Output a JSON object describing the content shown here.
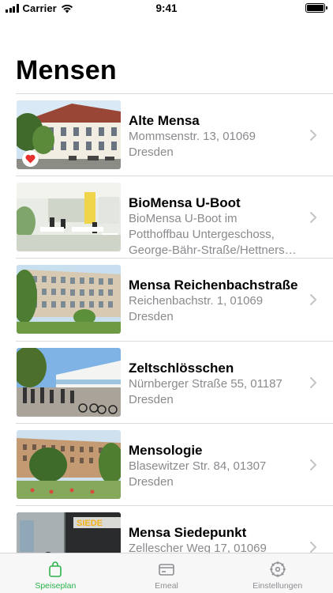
{
  "status_bar": {
    "carrier": "Carrier",
    "time": "9:41"
  },
  "page": {
    "title": "Mensen"
  },
  "mensen": [
    {
      "name": "Alte Mensa",
      "address_line1": "Mommsenstr. 13, 01069",
      "address_line2": "Dresden",
      "favorite": true,
      "image": "alte-mensa-photo"
    },
    {
      "name": "BioMensa U-Boot",
      "address_line1": "BioMensa U-Boot im",
      "address_line2": "Potthoffbau Untergeschoss,",
      "address_line3": "George-Bähr-Straße/Hettners…",
      "favorite": false,
      "image": "biomensa-photo"
    },
    {
      "name": "Mensa Reichenbachstraße",
      "address_line1": "Reichenbachstr. 1, 01069",
      "address_line2": "Dresden",
      "favorite": false,
      "image": "reichenbach-photo"
    },
    {
      "name": "Zeltschlösschen",
      "address_line1": "Nürnberger Straße 55, 01187",
      "address_line2": "Dresden",
      "favorite": false,
      "image": "zeltschloesschen-photo"
    },
    {
      "name": "Mensologie",
      "address_line1": "Blasewitzer Str. 84, 01307",
      "address_line2": "Dresden",
      "favorite": false,
      "image": "mensologie-photo"
    },
    {
      "name": "Mensa Siedepunkt",
      "address_line1": "Zellescher Weg 17, 01069",
      "address_line2": "",
      "favorite": false,
      "image": "siedepunkt-photo",
      "image_sign": "SIEDE"
    }
  ],
  "tab_bar": {
    "tabs": [
      {
        "label": "Speiseplan",
        "icon": "bag-icon",
        "active": true
      },
      {
        "label": "Emeal",
        "icon": "card-icon",
        "active": false
      },
      {
        "label": "Einstellungen",
        "icon": "gear-icon",
        "active": false
      }
    ]
  },
  "colors": {
    "accent": "#2bb24c",
    "secondary_text": "#8a8a8e",
    "heart": "#e8302f",
    "chevron": "#c4c4c7"
  }
}
